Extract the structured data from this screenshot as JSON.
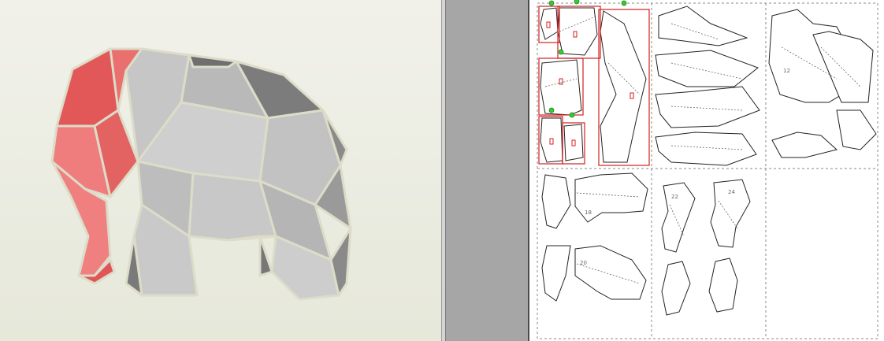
{
  "viewport_3d": {
    "model_icon": "elephant-lowpoly-model",
    "colors": {
      "background_top": "#f1f1ea",
      "background_bottom": "#e6e8da",
      "selected_part": "#e86b6b",
      "body_faces": "#c9c9c9",
      "edge_gap": "#dcdcc8"
    }
  },
  "view_2d": {
    "colors": {
      "page_bg": "#a6a6a6",
      "paper": "#ffffff",
      "selection_box": "#d02020",
      "anchor_dot": "#33cc33",
      "outline": "#222222"
    },
    "part_numbers": [
      "12",
      "18",
      "20",
      "22",
      "24"
    ]
  }
}
